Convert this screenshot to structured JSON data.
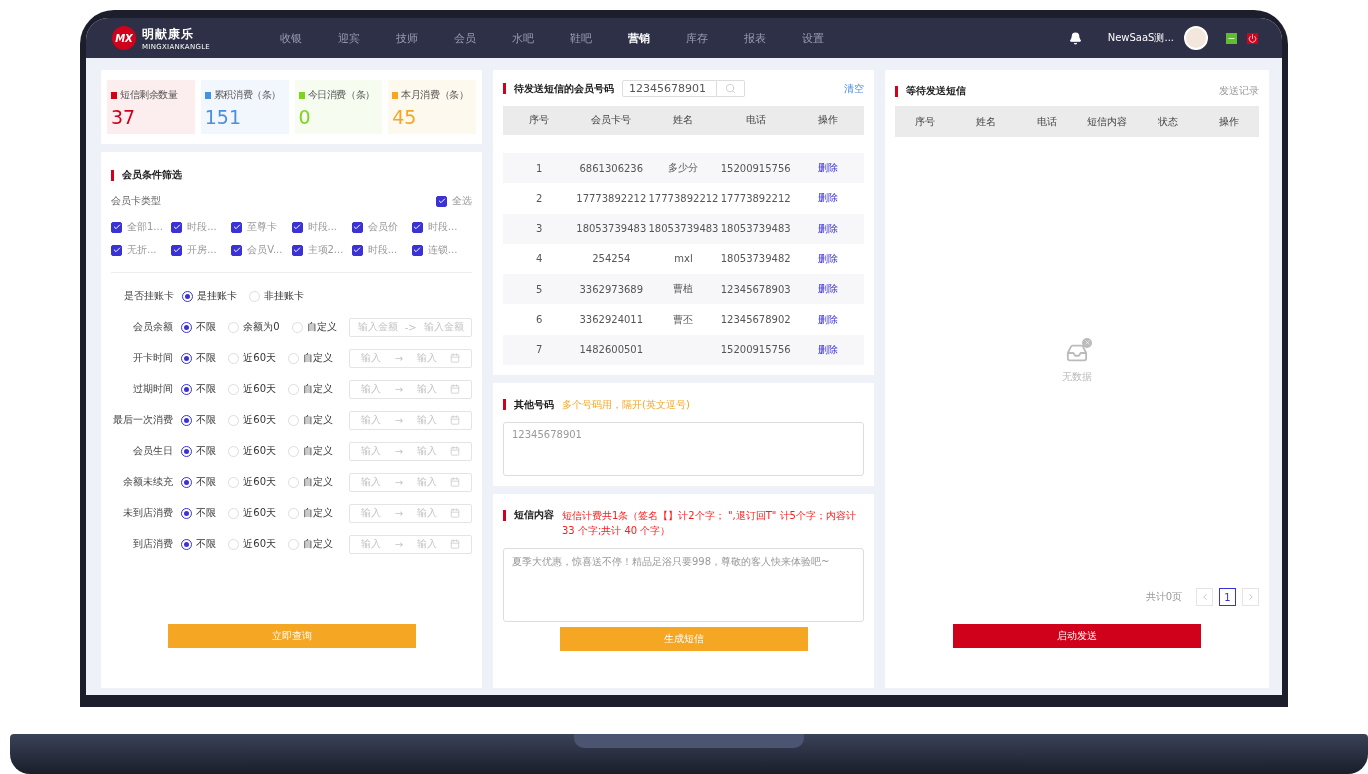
{
  "nav": {
    "logo_mark": "MX",
    "logo_text": "明献康乐",
    "logo_sub": "MINGXIANKANGLE",
    "items": [
      {
        "label": "收银",
        "selected": false
      },
      {
        "label": "迎宾",
        "selected": false
      },
      {
        "label": "技师",
        "selected": false
      },
      {
        "label": "会员",
        "selected": false
      },
      {
        "label": "水吧",
        "selected": false
      },
      {
        "label": "鞋吧",
        "selected": false
      },
      {
        "label": "营销",
        "selected": true
      },
      {
        "label": "库存",
        "selected": false
      },
      {
        "label": "报表",
        "selected": false
      },
      {
        "label": "设置",
        "selected": false
      }
    ],
    "user": "NewSaaS测..."
  },
  "stats": [
    {
      "label": "短信剩余数量",
      "value": "37",
      "color": "#d0021b"
    },
    {
      "label": "累积消费（条）",
      "value": "151",
      "color": "#4a90e2"
    },
    {
      "label": "今日消费（条）",
      "value": "0",
      "color": "#7ed321"
    },
    {
      "label": "本月消费（条）",
      "value": "45",
      "color": "#f5a623"
    }
  ],
  "filter": {
    "title": "会员条件筛选",
    "card_type_label": "会员卡类型",
    "select_all": {
      "label": "全选",
      "checked": true
    },
    "card_types": [
      {
        "label": "全部1...",
        "checked": true
      },
      {
        "label": "时段...",
        "checked": true
      },
      {
        "label": "至尊卡",
        "checked": true
      },
      {
        "label": "时段...",
        "checked": true
      },
      {
        "label": "会员价",
        "checked": true
      },
      {
        "label": "时段...",
        "checked": true
      },
      {
        "label": "无折...",
        "checked": true
      },
      {
        "label": "开房...",
        "checked": true
      },
      {
        "label": "会员V...",
        "checked": true
      },
      {
        "label": "主项2...",
        "checked": true
      },
      {
        "label": "时段...",
        "checked": true
      },
      {
        "label": "连锁...",
        "checked": true
      }
    ],
    "conditions": [
      {
        "label": "是否挂账卡",
        "options": [
          {
            "label": "是挂账卡",
            "selected": true
          },
          {
            "label": "非挂账卡",
            "selected": false
          }
        ]
      },
      {
        "label": "会员余额",
        "options": [
          {
            "label": "不限",
            "selected": true
          },
          {
            "label": "余额为0",
            "selected": false
          },
          {
            "label": "自定义",
            "selected": false
          }
        ],
        "range": {
          "kind": "amount",
          "from": "输入金额",
          "arrow": "->",
          "to": "输入金额"
        }
      },
      {
        "label": "开卡时间",
        "options": [
          {
            "label": "不限",
            "selected": true
          },
          {
            "label": "近60天",
            "selected": false
          },
          {
            "label": "自定义",
            "selected": false
          }
        ],
        "range": {
          "kind": "date",
          "from": "输入",
          "arrow": "→",
          "to": "输入"
        }
      },
      {
        "label": "过期时间",
        "options": [
          {
            "label": "不限",
            "selected": true
          },
          {
            "label": "近60天",
            "selected": false
          },
          {
            "label": "自定义",
            "selected": false
          }
        ],
        "range": {
          "kind": "date",
          "from": "输入",
          "arrow": "→",
          "to": "输入"
        }
      },
      {
        "label": "最后一次消费",
        "options": [
          {
            "label": "不限",
            "selected": true
          },
          {
            "label": "近60天",
            "selected": false
          },
          {
            "label": "自定义",
            "selected": false
          }
        ],
        "range": {
          "kind": "date",
          "from": "输入",
          "arrow": "→",
          "to": "输入"
        }
      },
      {
        "label": "会员生日",
        "options": [
          {
            "label": "不限",
            "selected": true
          },
          {
            "label": "近60天",
            "selected": false
          },
          {
            "label": "自定义",
            "selected": false
          }
        ],
        "range": {
          "kind": "date",
          "from": "输入",
          "arrow": "→",
          "to": "输入"
        }
      },
      {
        "label": "余额未续充",
        "options": [
          {
            "label": "不限",
            "selected": true
          },
          {
            "label": "近60天",
            "selected": false
          },
          {
            "label": "自定义",
            "selected": false
          }
        ],
        "range": {
          "kind": "date",
          "from": "输入",
          "arrow": "→",
          "to": "输入"
        }
      },
      {
        "label": "未到店消费",
        "options": [
          {
            "label": "不限",
            "selected": true
          },
          {
            "label": "近60天",
            "selected": false
          },
          {
            "label": "自定义",
            "selected": false
          }
        ],
        "range": {
          "kind": "date",
          "from": "输入",
          "arrow": "→",
          "to": "输入"
        }
      },
      {
        "label": "到店消费",
        "options": [
          {
            "label": "不限",
            "selected": true
          },
          {
            "label": "近60天",
            "selected": false
          },
          {
            "label": "自定义",
            "selected": false
          }
        ],
        "range": {
          "kind": "date",
          "from": "输入",
          "arrow": "→",
          "to": "输入"
        }
      }
    ],
    "query_button": "立即查询"
  },
  "members": {
    "title": "待发送短信的会员号码",
    "search_value": "12345678901",
    "clear": "清空",
    "columns": [
      "序号",
      "会员卡号",
      "姓名",
      "电话",
      "操作"
    ],
    "rows": [
      {
        "cells": [
          "1",
          "6861306236",
          "多少分",
          "15200915756"
        ],
        "action": "删除"
      },
      {
        "cells": [
          "2",
          "17773892212",
          "17773892212",
          "17773892212"
        ],
        "action": "删除"
      },
      {
        "cells": [
          "3",
          "18053739483",
          "18053739483",
          "18053739483"
        ],
        "action": "删除"
      },
      {
        "cells": [
          "4",
          "254254",
          "mxl",
          "18053739482"
        ],
        "action": "删除"
      },
      {
        "cells": [
          "5",
          "3362973689",
          "曹植",
          "12345678903"
        ],
        "action": "删除"
      },
      {
        "cells": [
          "6",
          "3362924011",
          "曹丕",
          "12345678902"
        ],
        "action": "删除"
      },
      {
        "cells": [
          "7",
          "1482600501",
          "",
          "15200915756"
        ],
        "action": "删除"
      }
    ]
  },
  "others": {
    "title": "其他号码",
    "hint": "多个号码用，隔开(英文逗号)",
    "placeholder": "12345678901"
  },
  "sms": {
    "title": "短信内容",
    "note": "短信计费共1条（签名【】计2个字；  \",退订回T\" 计5个字；内容计33 个字;共计 40 个字）",
    "placeholder": "夏季大优惠，惊喜送不停！精品足浴只要998，尊敬的客人快来体验吧~",
    "button": "生成短信"
  },
  "pending": {
    "title": "等待发送短信",
    "link": "发送记录",
    "columns": [
      "序号",
      "姓名",
      "电话",
      "短信内容",
      "状态",
      "操作"
    ],
    "empty": "无数据",
    "total": "共计0页",
    "pages": [
      {
        "label": "1",
        "selected": true
      }
    ],
    "button": "启动发送"
  }
}
